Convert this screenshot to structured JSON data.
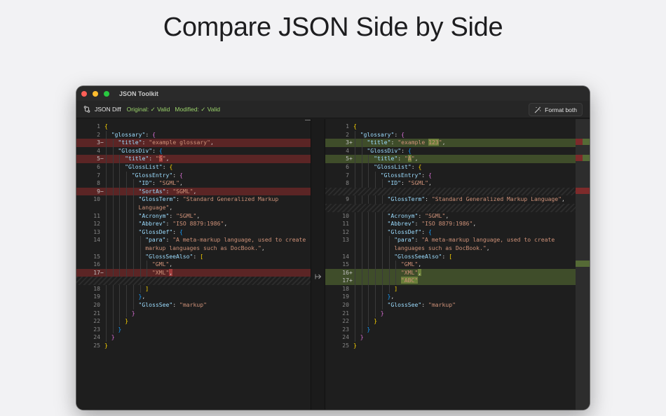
{
  "hero": {
    "title": "Compare JSON Side by Side"
  },
  "window": {
    "title": "JSON Toolkit"
  },
  "toolbar": {
    "mode_label": "JSON Diff",
    "original_status": "Original: ✓ Valid",
    "modified_status": "Modified: ✓ Valid",
    "format_button": "Format both"
  },
  "colors": {
    "deleted_line": "#5b2525",
    "added_line": "#3f4d2a",
    "valid_status": "#9bd36b"
  },
  "left_pane": {
    "lines": [
      {
        "n": "1",
        "type": "normal",
        "indent": 0,
        "segs": [
          [
            "{",
            "b1"
          ]
        ]
      },
      {
        "n": "2",
        "type": "normal",
        "indent": 1,
        "segs": [
          [
            "\"glossary\"",
            "k"
          ],
          [
            ": ",
            "p"
          ],
          [
            "{",
            "b2"
          ]
        ]
      },
      {
        "n": "3",
        "type": "del",
        "mark": "−",
        "indent": 2,
        "segs": [
          [
            "\"title\"",
            "k"
          ],
          [
            ": ",
            "p"
          ],
          [
            "\"example glossary\"",
            "s"
          ],
          [
            ",",
            "p"
          ]
        ]
      },
      {
        "n": "4",
        "type": "normal",
        "indent": 2,
        "segs": [
          [
            "\"GlossDiv\"",
            "k"
          ],
          [
            ": ",
            "p"
          ],
          [
            "{",
            "b3"
          ]
        ]
      },
      {
        "n": "5",
        "type": "del",
        "mark": "−",
        "indent": 3,
        "segs": [
          [
            "\"title\"",
            "k"
          ],
          [
            ": ",
            "p"
          ],
          [
            "\"",
            "s"
          ],
          [
            "S",
            "s hl-del"
          ],
          [
            "\"",
            "s"
          ],
          [
            ",",
            "p"
          ]
        ]
      },
      {
        "n": "6",
        "type": "normal",
        "indent": 3,
        "segs": [
          [
            "\"GlossList\"",
            "k"
          ],
          [
            ": ",
            "p"
          ],
          [
            "{",
            "b1"
          ]
        ]
      },
      {
        "n": "7",
        "type": "normal",
        "indent": 4,
        "segs": [
          [
            "\"GlossEntry\"",
            "k"
          ],
          [
            ": ",
            "p"
          ],
          [
            "{",
            "b2"
          ]
        ]
      },
      {
        "n": "8",
        "type": "normal",
        "indent": 5,
        "segs": [
          [
            "\"ID\"",
            "k"
          ],
          [
            ": ",
            "p"
          ],
          [
            "\"SGML\"",
            "s"
          ],
          [
            ",",
            "p"
          ]
        ]
      },
      {
        "n": "9",
        "type": "del",
        "mark": "−",
        "indent": 5,
        "segs": [
          [
            "\"SortAs\"",
            "k"
          ],
          [
            ": ",
            "p"
          ],
          [
            "\"SGML\"",
            "s"
          ],
          [
            ",",
            "p"
          ]
        ]
      },
      {
        "n": "10",
        "type": "normal",
        "indent": 5,
        "segs": [
          [
            "\"GlossTerm\"",
            "k"
          ],
          [
            ": ",
            "p"
          ],
          [
            "\"Standard Generalized Markup",
            "s"
          ]
        ]
      },
      {
        "n": "",
        "type": "normal",
        "indent": 5,
        "segs": [
          [
            "Language\"",
            "s"
          ],
          [
            ",",
            "p"
          ]
        ]
      },
      {
        "n": "11",
        "type": "normal",
        "indent": 5,
        "segs": [
          [
            "\"Acronym\"",
            "k"
          ],
          [
            ": ",
            "p"
          ],
          [
            "\"SGML\"",
            "s"
          ],
          [
            ",",
            "p"
          ]
        ]
      },
      {
        "n": "12",
        "type": "normal",
        "indent": 5,
        "segs": [
          [
            "\"Abbrev\"",
            "k"
          ],
          [
            ": ",
            "p"
          ],
          [
            "\"ISO 8879:1986\"",
            "s"
          ],
          [
            ",",
            "p"
          ]
        ]
      },
      {
        "n": "13",
        "type": "normal",
        "indent": 5,
        "segs": [
          [
            "\"GlossDef\"",
            "k"
          ],
          [
            ": ",
            "p"
          ],
          [
            "{",
            "b3"
          ]
        ]
      },
      {
        "n": "14",
        "type": "normal",
        "indent": 6,
        "segs": [
          [
            "\"para\"",
            "k"
          ],
          [
            ": ",
            "p"
          ],
          [
            "\"A meta-markup language, used to create",
            "s"
          ]
        ]
      },
      {
        "n": "",
        "type": "normal",
        "indent": 6,
        "segs": [
          [
            "markup languages such as DocBook.\"",
            "s"
          ],
          [
            ",",
            "p"
          ]
        ]
      },
      {
        "n": "15",
        "type": "normal",
        "indent": 6,
        "segs": [
          [
            "\"GlossSeeAlso\"",
            "k"
          ],
          [
            ": ",
            "p"
          ],
          [
            "[",
            "b1"
          ]
        ]
      },
      {
        "n": "16",
        "type": "normal",
        "indent": 7,
        "segs": [
          [
            "\"GML\"",
            "s"
          ],
          [
            ",",
            "p"
          ]
        ]
      },
      {
        "n": "17",
        "type": "del",
        "mark": "−",
        "indent": 7,
        "segs": [
          [
            "\"XML\"",
            "s"
          ],
          [
            ",",
            "p hl-del"
          ]
        ]
      },
      {
        "n": "",
        "type": "filler",
        "indent": 0,
        "segs": []
      },
      {
        "n": "18",
        "type": "normal",
        "indent": 6,
        "segs": [
          [
            "]",
            "b1"
          ]
        ]
      },
      {
        "n": "19",
        "type": "normal",
        "indent": 5,
        "segs": [
          [
            "}",
            "b3"
          ],
          [
            ",",
            "p"
          ]
        ]
      },
      {
        "n": "20",
        "type": "normal",
        "indent": 5,
        "segs": [
          [
            "\"GlossSee\"",
            "k"
          ],
          [
            ": ",
            "p"
          ],
          [
            "\"markup\"",
            "s"
          ]
        ]
      },
      {
        "n": "21",
        "type": "normal",
        "indent": 4,
        "segs": [
          [
            "}",
            "b2"
          ]
        ]
      },
      {
        "n": "22",
        "type": "normal",
        "indent": 3,
        "segs": [
          [
            "}",
            "b1"
          ]
        ]
      },
      {
        "n": "23",
        "type": "normal",
        "indent": 2,
        "segs": [
          [
            "}",
            "b3"
          ]
        ]
      },
      {
        "n": "24",
        "type": "normal",
        "indent": 1,
        "segs": [
          [
            "}",
            "b2"
          ]
        ]
      },
      {
        "n": "25",
        "type": "normal",
        "indent": 0,
        "segs": [
          [
            "}",
            "b1"
          ]
        ]
      }
    ]
  },
  "right_pane": {
    "lines": [
      {
        "n": "1",
        "type": "normal",
        "indent": 0,
        "segs": [
          [
            "{",
            "b1"
          ]
        ]
      },
      {
        "n": "2",
        "type": "normal",
        "indent": 1,
        "segs": [
          [
            "\"glossary\"",
            "k"
          ],
          [
            ": ",
            "p"
          ],
          [
            "{",
            "b2"
          ]
        ]
      },
      {
        "n": "3",
        "type": "add",
        "mark": "+",
        "indent": 2,
        "segs": [
          [
            "\"title\"",
            "k"
          ],
          [
            ": ",
            "p"
          ],
          [
            "\"example ",
            "s"
          ],
          [
            "123",
            "s hl-add"
          ],
          [
            "\"",
            "s"
          ],
          [
            ",",
            "p"
          ]
        ]
      },
      {
        "n": "4",
        "type": "normal",
        "indent": 2,
        "segs": [
          [
            "\"GlossDiv\"",
            "k"
          ],
          [
            ": ",
            "p"
          ],
          [
            "{",
            "b3"
          ]
        ]
      },
      {
        "n": "5",
        "type": "add",
        "mark": "+",
        "indent": 3,
        "segs": [
          [
            "\"title\"",
            "k"
          ],
          [
            ": ",
            "p"
          ],
          [
            "\"",
            "s"
          ],
          [
            "A",
            "s hl-add"
          ],
          [
            "\"",
            "s"
          ],
          [
            ",",
            "p"
          ]
        ]
      },
      {
        "n": "6",
        "type": "normal",
        "indent": 3,
        "segs": [
          [
            "\"GlossList\"",
            "k"
          ],
          [
            ": ",
            "p"
          ],
          [
            "{",
            "b1"
          ]
        ]
      },
      {
        "n": "7",
        "type": "normal",
        "indent": 4,
        "segs": [
          [
            "\"GlossEntry\"",
            "k"
          ],
          [
            ": ",
            "p"
          ],
          [
            "{",
            "b2"
          ]
        ]
      },
      {
        "n": "8",
        "type": "normal",
        "indent": 5,
        "segs": [
          [
            "\"ID\"",
            "k"
          ],
          [
            ": ",
            "p"
          ],
          [
            "\"SGML\"",
            "s"
          ],
          [
            ",",
            "p"
          ]
        ]
      },
      {
        "n": "",
        "type": "filler",
        "indent": 0,
        "segs": []
      },
      {
        "n": "9",
        "type": "normal",
        "indent": 5,
        "segs": [
          [
            "\"GlossTerm\"",
            "k"
          ],
          [
            ": ",
            "p"
          ],
          [
            "\"Standard Generalized Markup Language\"",
            "s"
          ],
          [
            ",",
            "p"
          ]
        ]
      },
      {
        "n": "",
        "type": "filler",
        "indent": 0,
        "segs": []
      },
      {
        "n": "10",
        "type": "normal",
        "indent": 5,
        "segs": [
          [
            "\"Acronym\"",
            "k"
          ],
          [
            ": ",
            "p"
          ],
          [
            "\"SGML\"",
            "s"
          ],
          [
            ",",
            "p"
          ]
        ]
      },
      {
        "n": "11",
        "type": "normal",
        "indent": 5,
        "segs": [
          [
            "\"Abbrev\"",
            "k"
          ],
          [
            ": ",
            "p"
          ],
          [
            "\"ISO 8879:1986\"",
            "s"
          ],
          [
            ",",
            "p"
          ]
        ]
      },
      {
        "n": "12",
        "type": "normal",
        "indent": 5,
        "segs": [
          [
            "\"GlossDef\"",
            "k"
          ],
          [
            ": ",
            "p"
          ],
          [
            "{",
            "b3"
          ]
        ]
      },
      {
        "n": "13",
        "type": "normal",
        "indent": 6,
        "segs": [
          [
            "\"para\"",
            "k"
          ],
          [
            ": ",
            "p"
          ],
          [
            "\"A meta-markup language, used to create",
            "s"
          ]
        ]
      },
      {
        "n": "",
        "type": "normal",
        "indent": 6,
        "segs": [
          [
            "languages such as DocBook.\"",
            "s"
          ],
          [
            ",",
            "p"
          ]
        ]
      },
      {
        "n": "14",
        "type": "normal",
        "indent": 6,
        "segs": [
          [
            "\"GlossSeeAlso\"",
            "k"
          ],
          [
            ": ",
            "p"
          ],
          [
            "[",
            "b1"
          ]
        ]
      },
      {
        "n": "15",
        "type": "normal",
        "indent": 7,
        "segs": [
          [
            "\"GML\"",
            "s"
          ],
          [
            ",",
            "p"
          ]
        ]
      },
      {
        "n": "16",
        "type": "add",
        "mark": "+",
        "indent": 7,
        "segs": [
          [
            "\"XML\"",
            "s"
          ],
          [
            ",",
            "p hl-add"
          ]
        ]
      },
      {
        "n": "17",
        "type": "add",
        "mark": "+",
        "indent": 7,
        "segs": [
          [
            "\"ABC\"",
            "s hl-add"
          ]
        ]
      },
      {
        "n": "18",
        "type": "normal",
        "indent": 6,
        "segs": [
          [
            "]",
            "b1"
          ]
        ]
      },
      {
        "n": "19",
        "type": "normal",
        "indent": 5,
        "segs": [
          [
            "}",
            "b3"
          ],
          [
            ",",
            "p"
          ]
        ]
      },
      {
        "n": "20",
        "type": "normal",
        "indent": 5,
        "segs": [
          [
            "\"GlossSee\"",
            "k"
          ],
          [
            ": ",
            "p"
          ],
          [
            "\"markup\"",
            "s"
          ]
        ]
      },
      {
        "n": "21",
        "type": "normal",
        "indent": 4,
        "segs": [
          [
            "}",
            "b2"
          ]
        ]
      },
      {
        "n": "22",
        "type": "normal",
        "indent": 3,
        "segs": [
          [
            "}",
            "b1"
          ]
        ]
      },
      {
        "n": "23",
        "type": "normal",
        "indent": 2,
        "segs": [
          [
            "}",
            "b3"
          ]
        ]
      },
      {
        "n": "24",
        "type": "normal",
        "indent": 1,
        "segs": [
          [
            "}",
            "b2"
          ]
        ]
      },
      {
        "n": "25",
        "type": "normal",
        "indent": 0,
        "segs": [
          [
            "}",
            "b1"
          ]
        ]
      }
    ]
  },
  "minimap": {
    "marks": [
      {
        "line": 3,
        "type": "half-green"
      },
      {
        "line": 5,
        "type": "half-green"
      },
      {
        "line": 9,
        "type": "red"
      },
      {
        "line": 18,
        "type": "green"
      }
    ]
  }
}
